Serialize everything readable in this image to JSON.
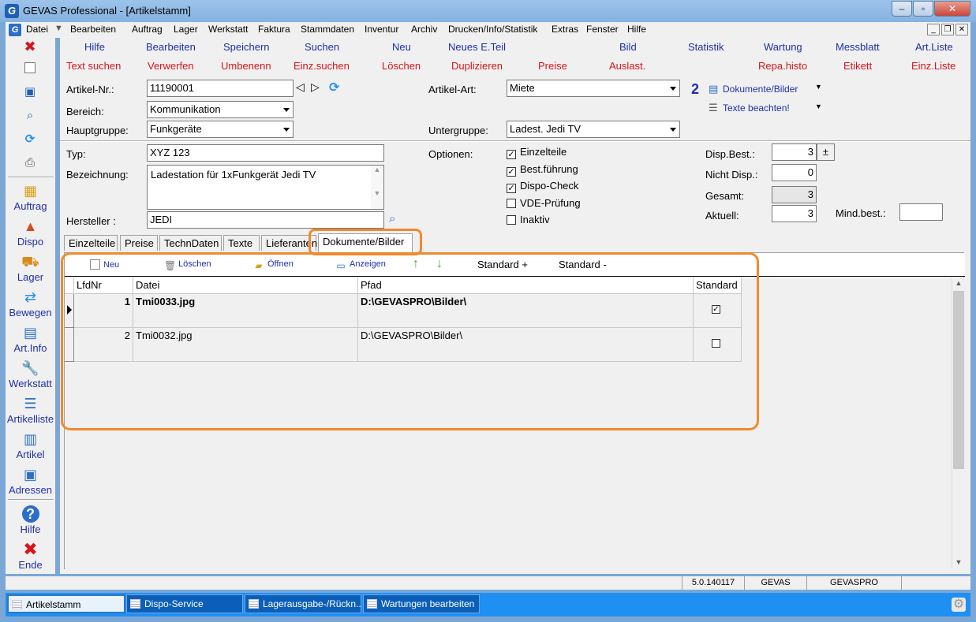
{
  "window": {
    "title": "GEVAS Professional - [Artikelstamm]"
  },
  "menu": {
    "items": [
      {
        "label": "Datei"
      },
      {
        "label": "Bearbeiten"
      },
      {
        "label": "Auftrag"
      },
      {
        "label": "Lager"
      },
      {
        "label": "Werkstatt"
      },
      {
        "label": "Faktura"
      },
      {
        "label": "Stammdaten"
      },
      {
        "label": "Inventur"
      },
      {
        "label": "Archiv"
      },
      {
        "label": "Drucken/Info/Statistik"
      },
      {
        "label": "Extras"
      },
      {
        "label": "Fenster"
      },
      {
        "label": "Hilfe"
      }
    ]
  },
  "toolbar": {
    "row1": [
      "Hilfe",
      "Bearbeiten",
      "Speichern",
      "Suchen",
      "Neu",
      "Neues E.Teil",
      "Bild",
      "Statistik",
      "Wartung",
      "Messblatt",
      "Art.Liste"
    ],
    "row2": [
      "Text suchen",
      "Verwerfen",
      "Umbenenn",
      "Einz.suchen",
      "Löschen",
      "Duplizieren",
      "Preise",
      "Auslast.",
      "Repa.histo",
      "Etikett",
      "Einz.Liste"
    ]
  },
  "sidebar": {
    "items": [
      "Auftrag",
      "Dispo",
      "Lager",
      "Bewegen",
      "Art.Info",
      "Werkstatt",
      "Artikelliste",
      "Artikel",
      "Adressen",
      "Hilfe",
      "Ende"
    ]
  },
  "form": {
    "artikel_nr_label": "Artikel-Nr.:",
    "artikel_nr": "11190001",
    "bereich_label": "Bereich:",
    "bereich": "Kommunikation",
    "hauptgruppe_label": "Hauptgruppe:",
    "hauptgruppe": "Funkgeräte",
    "artikel_art_label": "Artikel-Art:",
    "artikel_art": "Miete",
    "untergruppe_label": "Untergruppe:",
    "untergruppe": "Ladest. Jedi TV",
    "doc_count": "2",
    "dokumente_link": "Dokumente/Bilder",
    "texte_link": "Texte beachten!",
    "typ_label": "Typ:",
    "typ": "XYZ 123",
    "bezeichnung_label": "Bezeichnung:",
    "bezeichnung": "Ladestation für 1xFunkgerät Jedi TV",
    "hersteller_label": "Hersteller :",
    "hersteller": "JEDI",
    "optionen_label": "Optionen:",
    "options": [
      {
        "label": "Einzelteile",
        "checked": true
      },
      {
        "label": "Best.führung",
        "checked": true
      },
      {
        "label": "Dispo-Check",
        "checked": true
      },
      {
        "label": "VDE-Prüfung",
        "checked": false
      },
      {
        "label": "Inaktiv",
        "checked": false
      }
    ],
    "disp_best_label": "Disp.Best.:",
    "disp_best": "3",
    "plusminus": "±",
    "nicht_disp_label": "Nicht Disp.:",
    "nicht_disp": "0",
    "gesamt_label": "Gesamt:",
    "gesamt": "3",
    "aktuell_label": "Aktuell:",
    "aktuell": "3",
    "mind_best_label": "Mind.best.:",
    "mind_best": ""
  },
  "tabs": [
    "Einzelteile",
    "Preise",
    "TechnDaten",
    "Texte",
    "Lieferanten",
    "Dokumente/Bilder"
  ],
  "doc_toolbar": {
    "neu": "Neu",
    "loeschen": "Löschen",
    "oeffnen": "Öffnen",
    "anzeigen": "Anzeigen",
    "standard_plus": "Standard +",
    "standard_minus": "Standard -"
  },
  "grid": {
    "headers": {
      "lfdnr": "LfdNr",
      "datei": "Datei",
      "pfad": "Pfad",
      "standard": "Standard"
    },
    "rows": [
      {
        "lfdnr": "1",
        "datei": "Tmi0033.jpg",
        "pfad": "D:\\GEVASPRO\\Bilder\\",
        "standard": true
      },
      {
        "lfdnr": "2",
        "datei": "Tmi0032.jpg",
        "pfad": "D:\\GEVASPRO\\Bilder\\",
        "standard": false
      }
    ]
  },
  "status": {
    "version": "5.0.140117",
    "app": "GEVAS",
    "db": "GEVASPRO"
  },
  "taskbar": [
    "Artikelstamm",
    "Dispo-Service",
    "Lagerausgabe-/Rückn...",
    "Wartungen bearbeiten"
  ],
  "colors": {
    "highlight": "#f08a2c",
    "link_blue": "#1f2fa8",
    "link_red": "#d8141a"
  }
}
